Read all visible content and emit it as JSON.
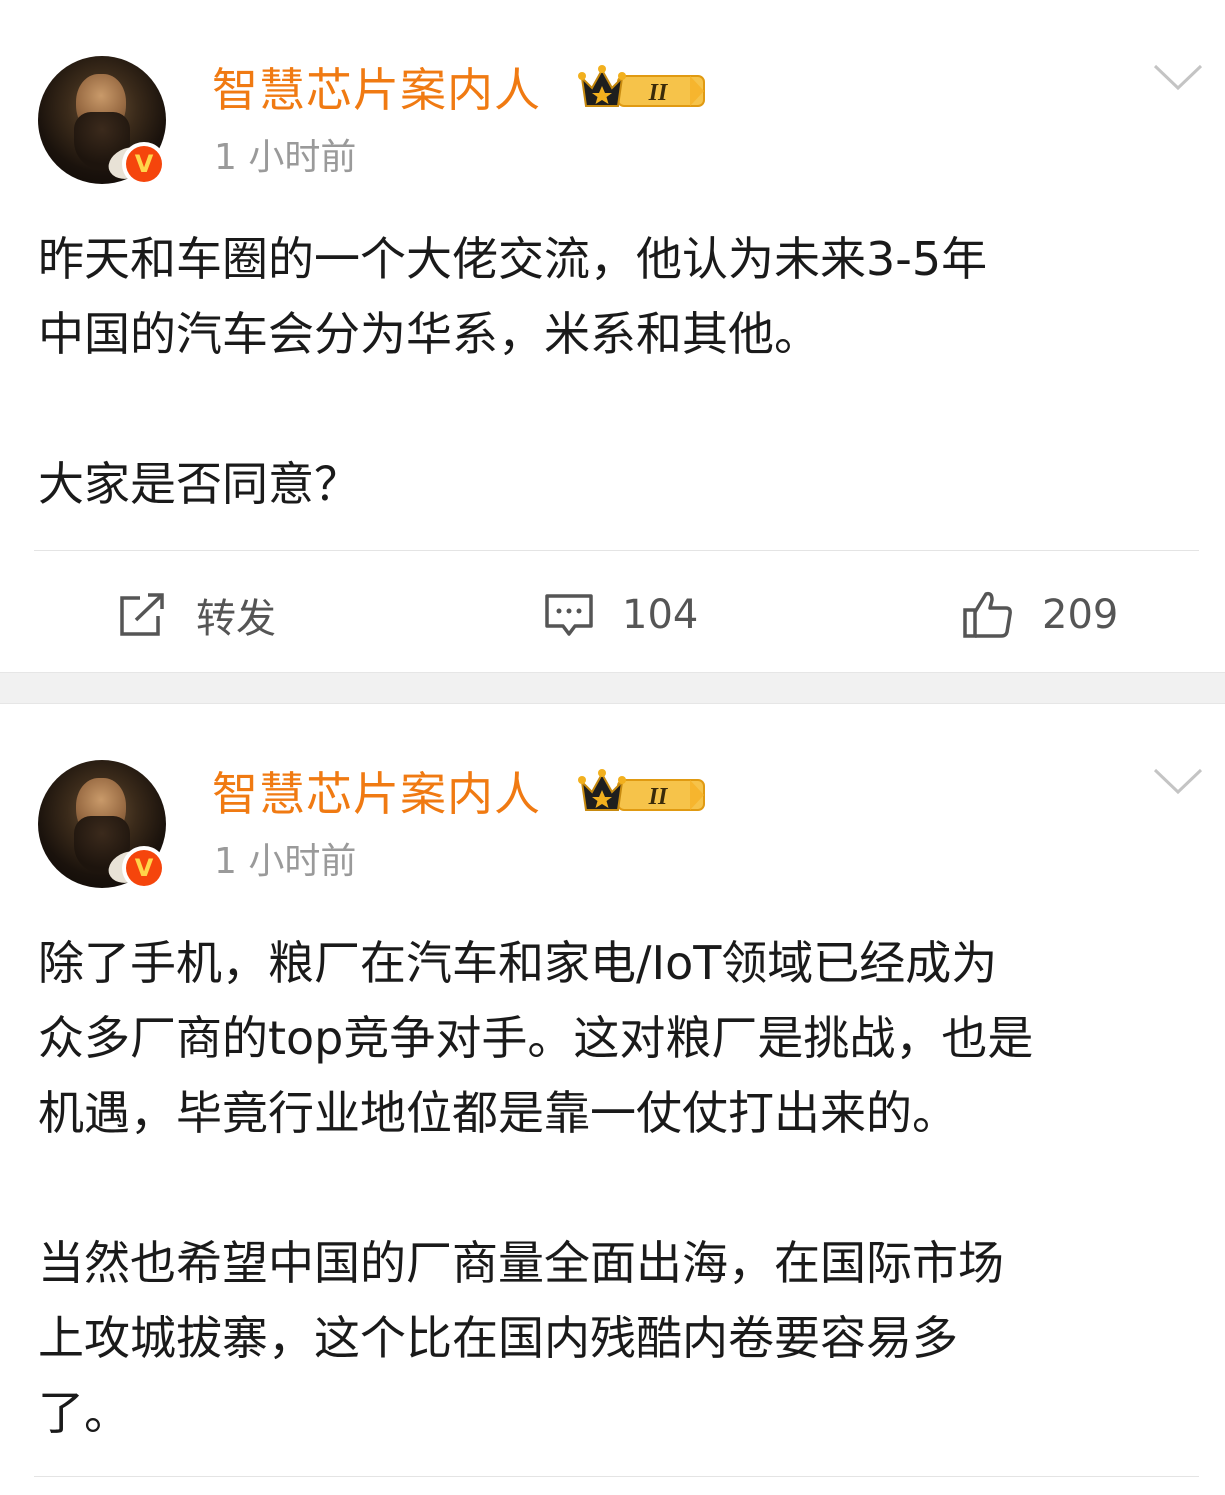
{
  "posts": [
    {
      "username": "智慧芯片案内人",
      "time": "1 小时前",
      "level_badge": "II",
      "paragraphs": [
        "昨天和车圈的一个大佬交流，他认为未来3-5年",
        "中国的汽车会分为华系，米系和其他。",
        "",
        "大家是否同意？"
      ],
      "actions": {
        "repost_label": "转发",
        "comment_count": "104",
        "like_count": "209"
      }
    },
    {
      "username": "智慧芯片案内人",
      "time": "1 小时前",
      "level_badge": "II",
      "paragraphs": [
        "除了手机，粮厂在汽车和家电/IoT领域已经成为",
        "众多厂商的top竞争对手。这对粮厂是挑战，也是",
        "机遇，毕竟行业地位都是靠一仗仗打出来的。",
        "",
        "当然也希望中国的厂商量全面出海，在国际市场",
        "上攻城拔寨，这个比在国内残酷内卷要容易多",
        "了。"
      ]
    }
  ],
  "icons": {
    "verified": "verified-v-icon",
    "crown": "crown-level-icon",
    "chevron": "chevron-down-icon",
    "repost": "repost-icon",
    "comment": "comment-icon",
    "like": "thumbs-up-icon"
  },
  "colors": {
    "username": "#f07a12",
    "timestamp": "#9a9a9a",
    "verified_badge": "#f5450c",
    "crown": "#f2b01e"
  }
}
